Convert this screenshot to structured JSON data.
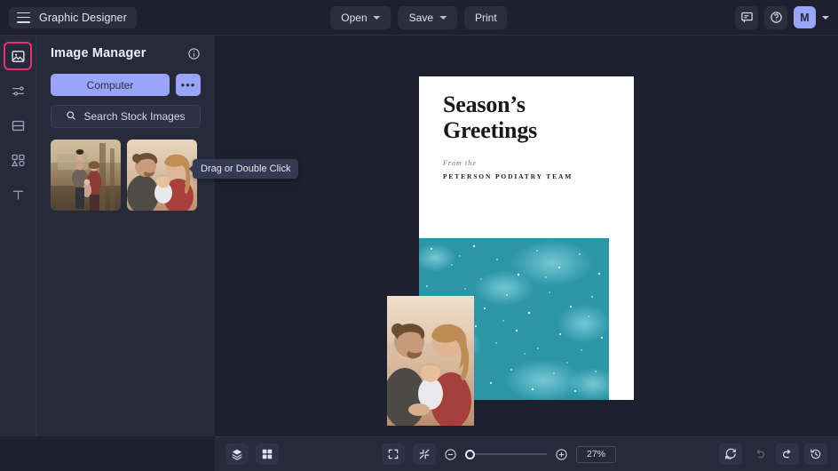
{
  "topbar": {
    "menu_icon": "hamburger-icon",
    "brand_title": "Graphic Designer",
    "buttons": [
      {
        "label": "Open",
        "has_caret": true
      },
      {
        "label": "Save",
        "has_caret": true
      },
      {
        "label": "Print",
        "has_caret": false
      }
    ],
    "chat_icon": "chat-icon",
    "help_icon": "help-icon",
    "avatar_initial": "M"
  },
  "rail": {
    "items": [
      {
        "name": "image-manager",
        "icon": "image-icon",
        "active": true
      },
      {
        "name": "adjustments",
        "icon": "sliders-icon",
        "active": false
      },
      {
        "name": "layouts",
        "icon": "frame-icon",
        "active": false
      },
      {
        "name": "shapes",
        "icon": "shapes-icon",
        "active": false
      },
      {
        "name": "text",
        "icon": "text-icon",
        "active": false
      }
    ]
  },
  "panel": {
    "title": "Image Manager",
    "info_icon": "info-icon",
    "computer_button": "Computer",
    "more_button": "•••",
    "search_icon": "search-icon",
    "search_button": "Search Stock Images",
    "thumbnails": [
      {
        "name": "thumbnail-family-outdoors",
        "alt": "family outdoors autumn"
      },
      {
        "name": "thumbnail-couple-baby",
        "alt": "couple with baby at sunset"
      }
    ],
    "tooltip": "Drag or Double Click"
  },
  "canvas": {
    "document": {
      "title_line1": "Season’s",
      "title_line2": "Greetings",
      "from_label": "From the",
      "team_name": "PETERSON PODIATRY TEAM",
      "teal_color": "#2b96a8",
      "page_color": "#ffffff"
    }
  },
  "bottombar": {
    "layers_icon": "layers-icon",
    "grid_icon": "grid-icon",
    "fullscreen_icon": "fullscreen-icon",
    "fit_icon": "fit-to-screen-icon",
    "zoom_out_icon": "zoom-out-icon",
    "zoom_in_icon": "zoom-in-icon",
    "zoom_value": "27%",
    "reset_icon": "reset-icon",
    "undo_icon": "undo-icon",
    "redo_icon": "redo-icon",
    "history_icon": "history-icon"
  },
  "colors": {
    "accent": "#9aa4fa",
    "active_outline": "#e8336d",
    "panel_bg": "#262a3a",
    "canvas_bg": "#1e2030",
    "teal": "#2b96a8"
  }
}
